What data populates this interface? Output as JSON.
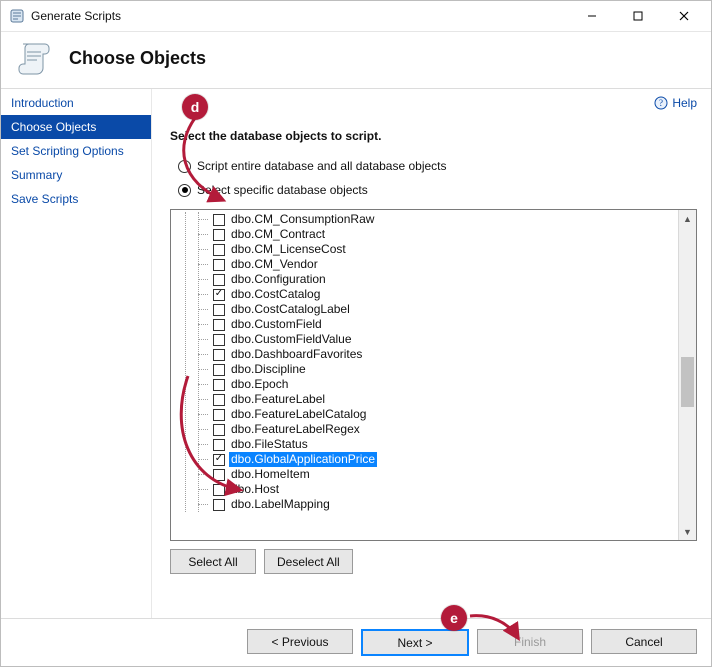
{
  "window": {
    "title": "Generate Scripts"
  },
  "header": {
    "title": "Choose Objects"
  },
  "sidebar": {
    "items": [
      {
        "label": "Introduction",
        "active": false
      },
      {
        "label": "Choose Objects",
        "active": true
      },
      {
        "label": "Set Scripting Options",
        "active": false
      },
      {
        "label": "Summary",
        "active": false
      },
      {
        "label": "Save Scripts",
        "active": false
      }
    ]
  },
  "help": {
    "label": "Help"
  },
  "main": {
    "instruction": "Select the database objects to script.",
    "radio_all": "Script entire database and all database objects",
    "radio_specific": "Select specific database objects",
    "selected_option_index": 1
  },
  "tree": {
    "items": [
      {
        "label": "dbo.CM_ConsumptionRaw",
        "checked": false,
        "highlighted": false
      },
      {
        "label": "dbo.CM_Contract",
        "checked": false,
        "highlighted": false
      },
      {
        "label": "dbo.CM_LicenseCost",
        "checked": false,
        "highlighted": false
      },
      {
        "label": "dbo.CM_Vendor",
        "checked": false,
        "highlighted": false
      },
      {
        "label": "dbo.Configuration",
        "checked": false,
        "highlighted": false
      },
      {
        "label": "dbo.CostCatalog",
        "checked": true,
        "highlighted": false
      },
      {
        "label": "dbo.CostCatalogLabel",
        "checked": false,
        "highlighted": false
      },
      {
        "label": "dbo.CustomField",
        "checked": false,
        "highlighted": false
      },
      {
        "label": "dbo.CustomFieldValue",
        "checked": false,
        "highlighted": false
      },
      {
        "label": "dbo.DashboardFavorites",
        "checked": false,
        "highlighted": false
      },
      {
        "label": "dbo.Discipline",
        "checked": false,
        "highlighted": false
      },
      {
        "label": "dbo.Epoch",
        "checked": false,
        "highlighted": false
      },
      {
        "label": "dbo.FeatureLabel",
        "checked": false,
        "highlighted": false
      },
      {
        "label": "dbo.FeatureLabelCatalog",
        "checked": false,
        "highlighted": false
      },
      {
        "label": "dbo.FeatureLabelRegex",
        "checked": false,
        "highlighted": false
      },
      {
        "label": "dbo.FileStatus",
        "checked": false,
        "highlighted": false
      },
      {
        "label": "dbo.GlobalApplicationPrice",
        "checked": true,
        "highlighted": true
      },
      {
        "label": "dbo.HomeItem",
        "checked": false,
        "highlighted": false
      },
      {
        "label": "dbo.Host",
        "checked": false,
        "highlighted": false
      },
      {
        "label": "dbo.LabelMapping",
        "checked": false,
        "highlighted": false
      }
    ],
    "select_all_label": "Select All",
    "deselect_all_label": "Deselect All"
  },
  "footer": {
    "previous": "< Previous",
    "next": "Next >",
    "finish": "Finish",
    "cancel": "Cancel"
  },
  "annotations": {
    "d": "d",
    "e": "e"
  }
}
